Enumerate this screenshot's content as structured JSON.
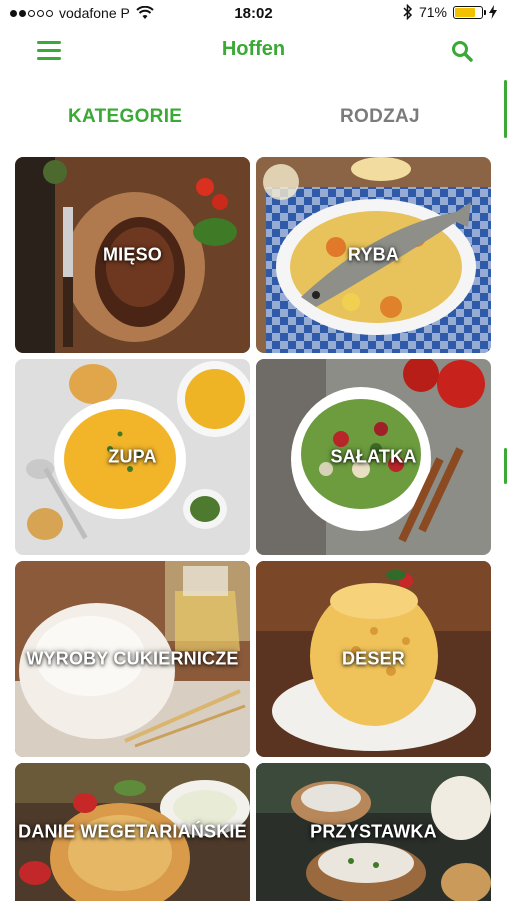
{
  "status_bar": {
    "carrier": "vodafone P",
    "time": "18:02",
    "battery": "71%",
    "battery_level": 0.71
  },
  "header": {
    "title": "Hoffen",
    "menu_icon": "hamburger-menu-icon",
    "search_icon": "search-icon"
  },
  "tabs": [
    {
      "label": "KATEGORIE",
      "active": true
    },
    {
      "label": "RODZAJ",
      "active": false
    }
  ],
  "categories": [
    {
      "label": "MIĘSO"
    },
    {
      "label": "RYBA"
    },
    {
      "label": "ZUPA"
    },
    {
      "label": "SAŁATKA"
    },
    {
      "label": "WYROBY CUKIERNICZE"
    },
    {
      "label": "DESER"
    },
    {
      "label": "DANIE WEGETARIAŃSKIE"
    },
    {
      "label": "PRZYSTAWKA"
    }
  ],
  "colors": {
    "accent": "#3aa935",
    "inactive_tab": "#7b7b7b",
    "battery": "#f2c200"
  }
}
